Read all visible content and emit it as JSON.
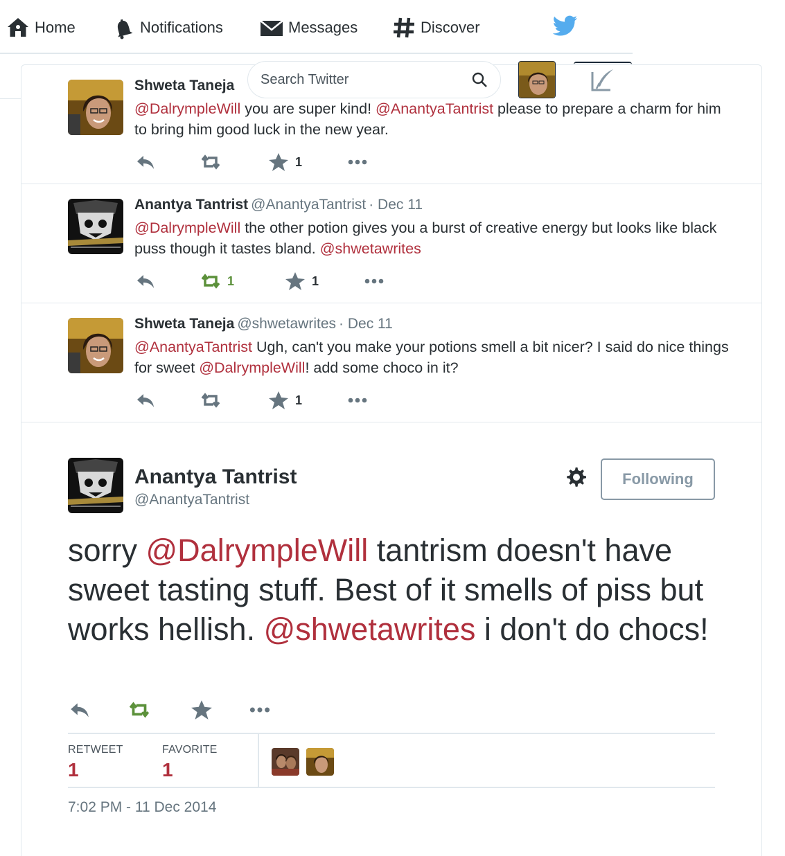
{
  "nav": {
    "home": "Home",
    "notifications": "Notifications",
    "messages": "Messages",
    "discover": "Discover"
  },
  "search": {
    "placeholder": "Search Twitter"
  },
  "colors": {
    "mention": "#b0303d",
    "retweet_active": "#5c913b",
    "icon": "#66757f",
    "brand": "#55acee"
  },
  "tweets": [
    {
      "name": "Shweta Taneja",
      "handle": "",
      "date": "",
      "segments": [
        {
          "t": "@DalrympleWill",
          "m": true
        },
        {
          "t": " you are super kind! ",
          "m": false
        },
        {
          "t": "@AnantyaTantrist",
          "m": true
        },
        {
          "t": " please to prepare a charm for him to bring him good luck in the new year.",
          "m": false
        }
      ],
      "retweets": "",
      "favorites": "1"
    },
    {
      "name": "Anantya Tantrist",
      "handle": "@AnantyaTantrist",
      "date": "· Dec 11",
      "segments": [
        {
          "t": "@DalrympleWill",
          "m": true
        },
        {
          "t": " the other potion gives you a burst of creative energy but looks like black puss though it tastes bland. ",
          "m": false
        },
        {
          "t": "@shwetawrites",
          "m": true
        }
      ],
      "retweets": "1",
      "favorites": "1"
    },
    {
      "name": "Shweta Taneja",
      "handle": "@shwetawrites",
      "date": "· Dec 11",
      "segments": [
        {
          "t": "@AnantyaTantrist",
          "m": true
        },
        {
          "t": " Ugh, can't you make your potions smell a bit nicer? I said do nice things for sweet ",
          "m": false
        },
        {
          "t": "@DalrympleWill",
          "m": true
        },
        {
          "t": "! add some choco in it?",
          "m": false
        }
      ],
      "retweets": "",
      "favorites": "1"
    }
  ],
  "main": {
    "name": "Anantya Tantrist",
    "handle": "@AnantyaTantrist",
    "follow_label": "Following",
    "segments": [
      {
        "t": "sorry ",
        "m": false
      },
      {
        "t": "@DalrympleWill",
        "m": true
      },
      {
        "t": " tantrism doesn't have sweet tasting stuff. Best of it smells of piss but works hellish. ",
        "m": false
      },
      {
        "t": "@shwetawrites",
        "m": true
      },
      {
        "t": " i don't do chocs!",
        "m": false
      }
    ],
    "retweet_label": "RETWEET",
    "retweet_count": "1",
    "favorite_label": "FAVORITE",
    "favorite_count": "1",
    "timestamp": "7:02 PM - 11 Dec 2014"
  }
}
